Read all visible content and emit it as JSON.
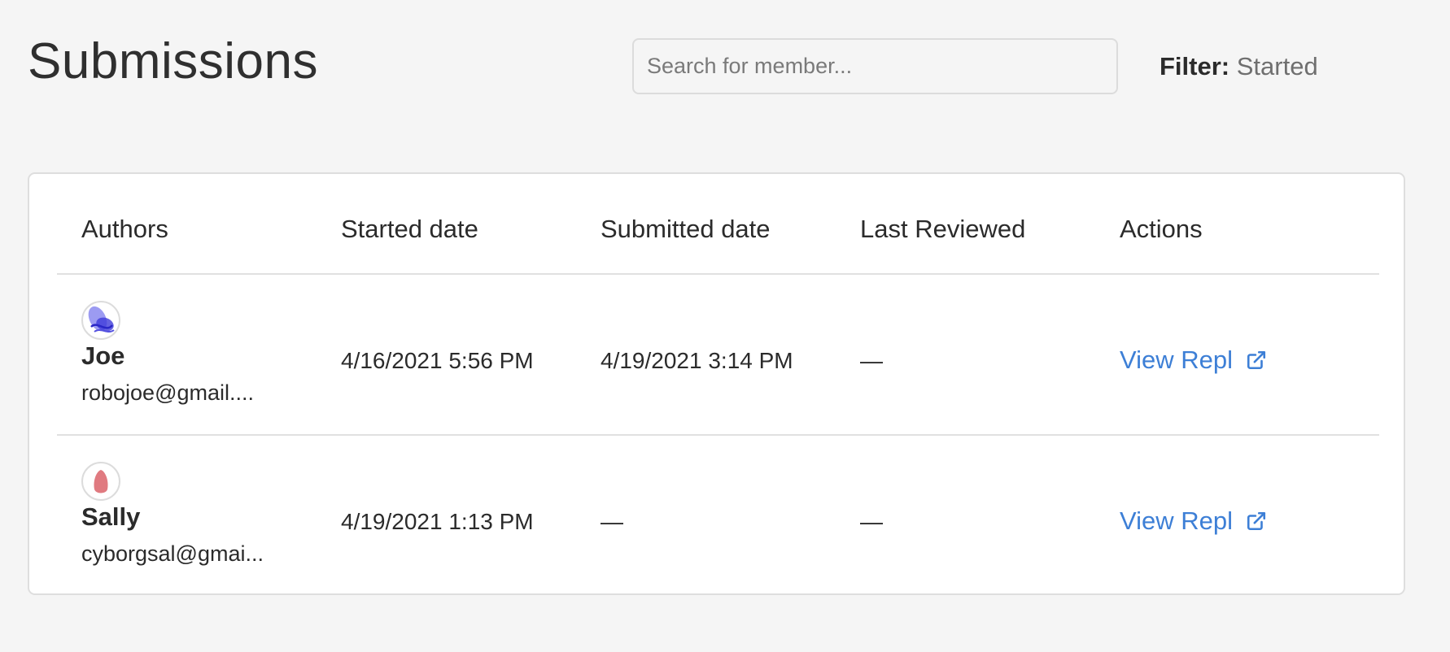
{
  "page": {
    "title": "Submissions"
  },
  "search": {
    "placeholder": "Search for member..."
  },
  "filter": {
    "label": "Filter:",
    "value": "Started"
  },
  "table": {
    "columns": [
      "Authors",
      "Started date",
      "Submitted date",
      "Last Reviewed",
      "Actions"
    ],
    "rows": [
      {
        "author_name": "Joe",
        "author_email": "robojoe@gmail....",
        "started": "4/16/2021 5:56 PM",
        "submitted": "4/19/2021 3:14 PM",
        "last_reviewed": "—",
        "action_label": "View Repl",
        "avatar_color": "#5a57e6"
      },
      {
        "author_name": "Sally",
        "author_email": "cyborgsal@gmai...",
        "started": "4/19/2021 1:13 PM",
        "submitted": "—",
        "last_reviewed": "—",
        "action_label": "View Repl",
        "avatar_color": "#e07a80"
      }
    ]
  },
  "colors": {
    "background": "#f5f5f5",
    "link": "#3d7fd6",
    "border": "#dedede"
  },
  "icons": {
    "action_icon": "external-link-icon"
  }
}
